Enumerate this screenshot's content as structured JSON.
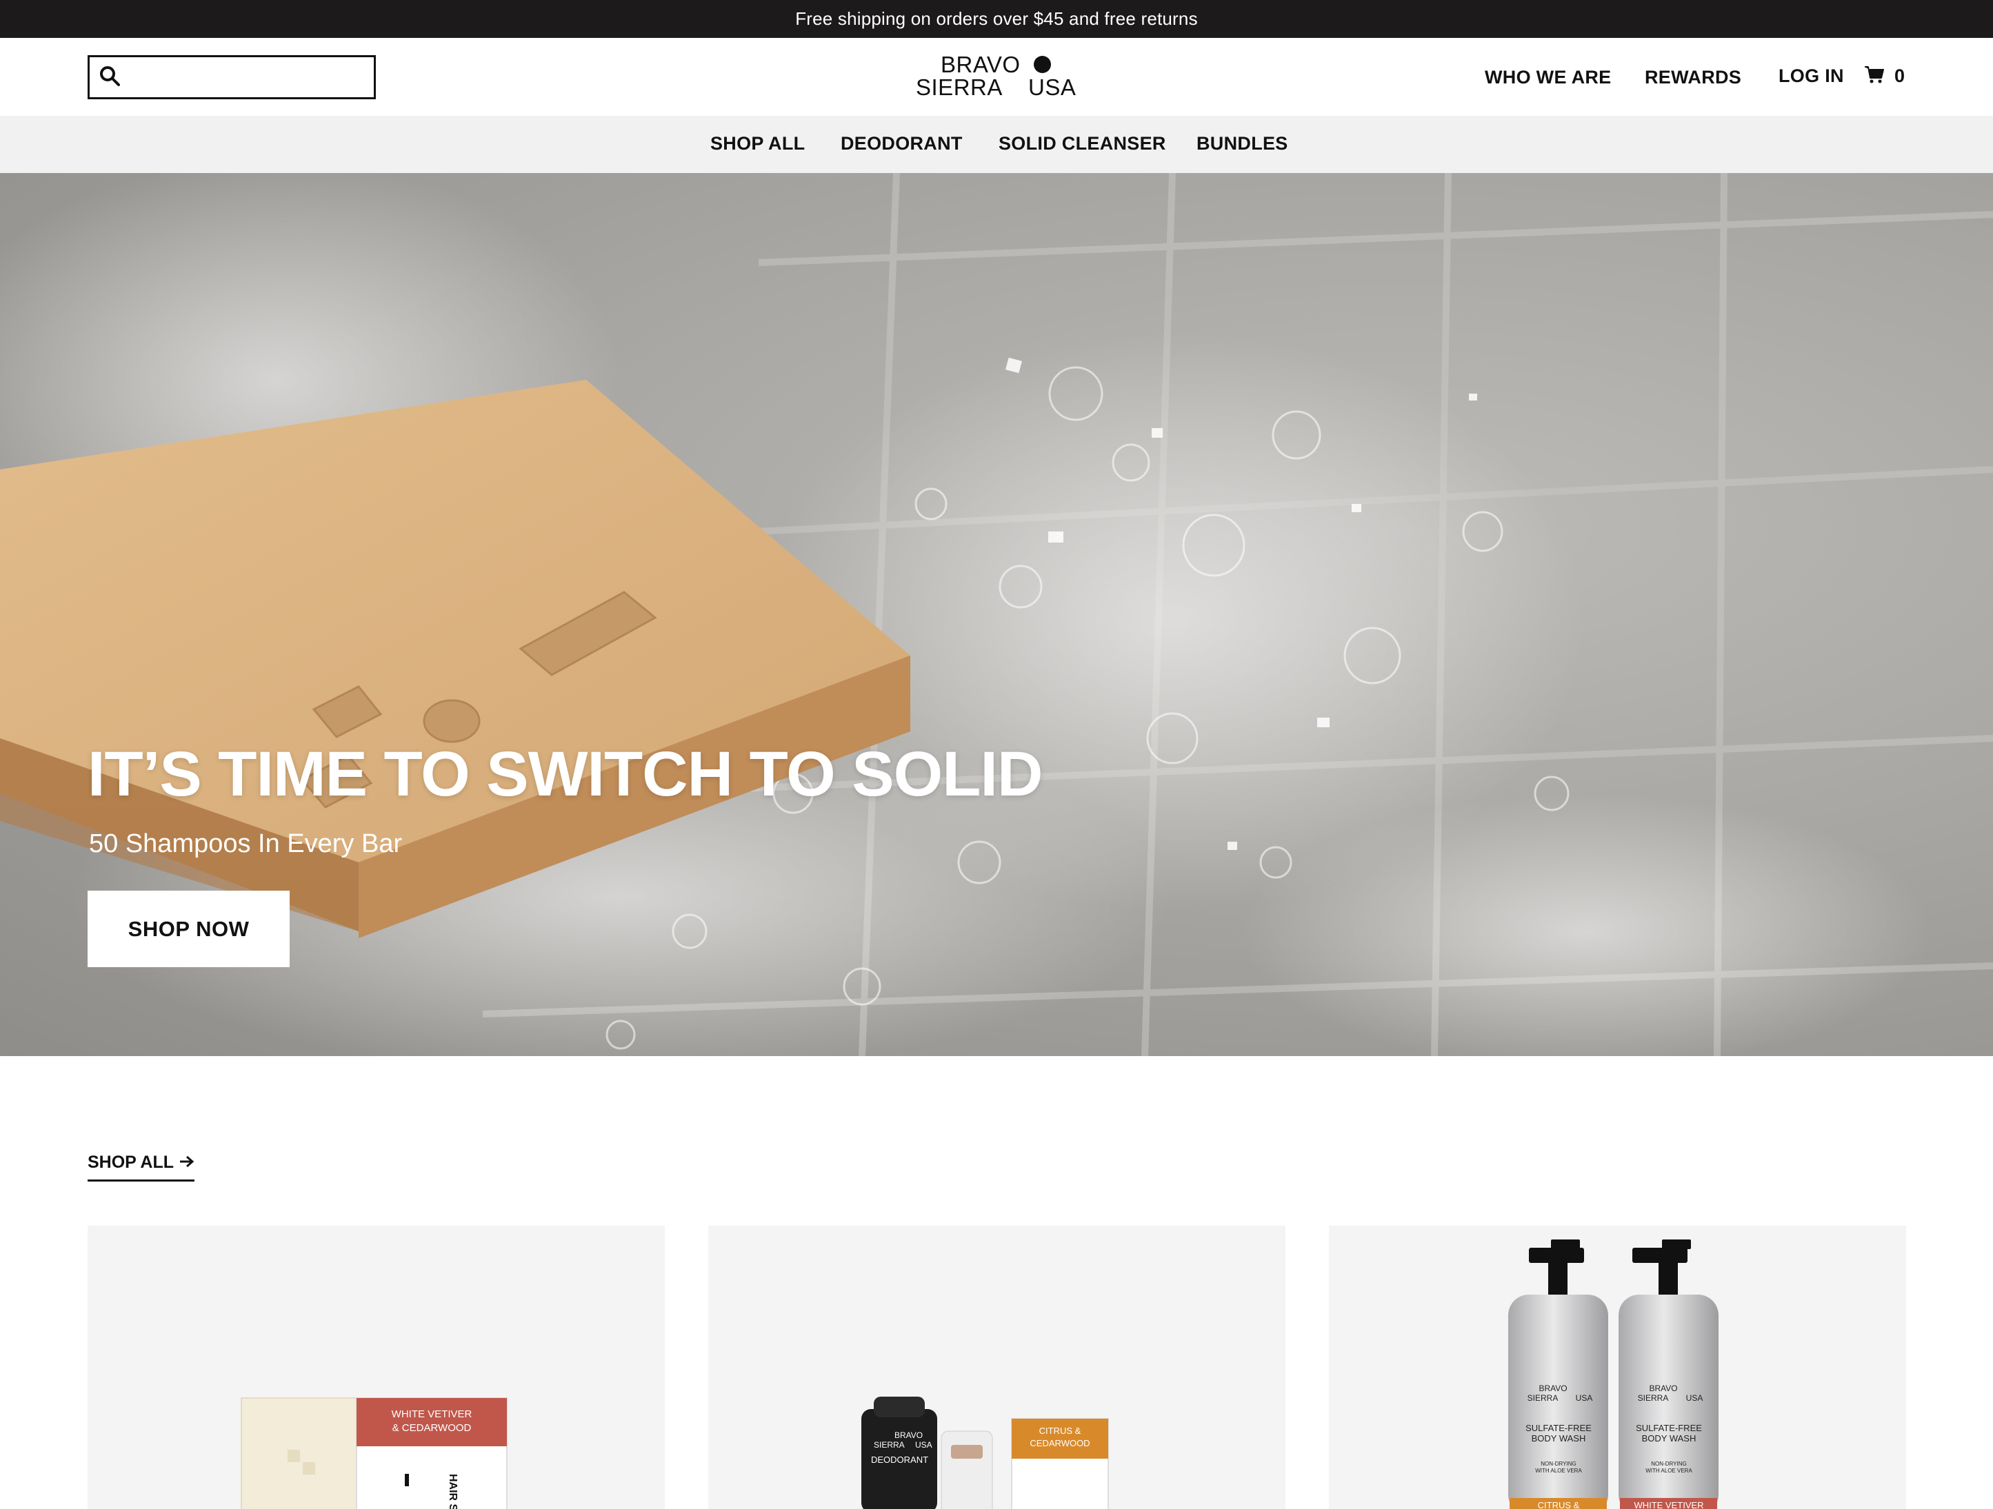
{
  "announcement": "Free shipping on orders over $45 and free returns",
  "header": {
    "search_placeholder": "",
    "logo": {
      "line1": "BRAVO",
      "line2": "SIERRA",
      "line3": "USA"
    },
    "nav": {
      "who_we_are": "WHO WE ARE",
      "rewards": "REWARDS",
      "login": "LOG IN"
    },
    "cart_count": "0"
  },
  "categories": [
    "SHOP ALL",
    "DEODORANT",
    "SOLID CLEANSER",
    "BUNDLES"
  ],
  "hero": {
    "title": "IT’S TIME TO SWITCH TO SOLID",
    "subtitle": "50 Shampoos In Every Bar",
    "cta": "SHOP NOW"
  },
  "shop_all_link": "SHOP ALL",
  "products": [
    {
      "box_label_1": "WHITE VETIVER",
      "box_label_2": "& CEDARWOOD",
      "box_side": "HAIR SOLID"
    },
    {
      "can_brand_1": "BRAVO",
      "can_brand_2": "SIERRA",
      "can_brand_3": "USA",
      "can_name": "DEODORANT",
      "box_label_1": "CITRUS &",
      "box_label_2": "CEDARWOOD"
    },
    {
      "brand_1": "BRAVO",
      "brand_2": "SIERRA",
      "brand_3": "USA",
      "name_1": "SULFATE-FREE",
      "name_2": "BODY WASH",
      "note_1": "NON-DRYING",
      "note_2": "WITH ALOE VERA",
      "scent_left": "CITRUS &",
      "scent_right": "WHITE VETIVER"
    }
  ],
  "colors": {
    "announcement_bg": "#1c1a1b",
    "category_bg": "#f1f1f1",
    "card_bg": "#f4f4f4",
    "soap": "#d6ad7c",
    "vetiver_red": "#c0574a",
    "citrus_orange": "#d88a2a"
  },
  "icons": [
    "search-icon",
    "cart-icon",
    "arrow-right-icon"
  ]
}
